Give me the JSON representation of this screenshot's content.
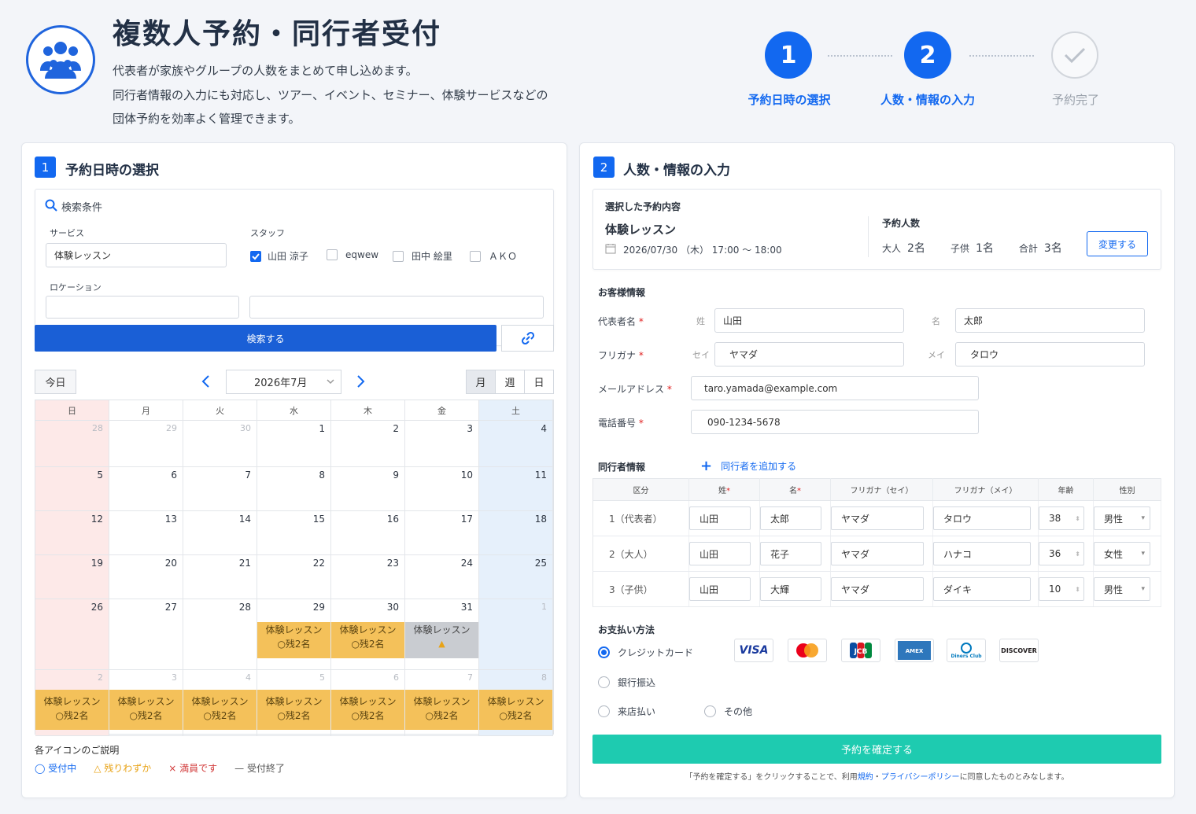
{
  "header": {
    "title": "複数人予約・同行者受付",
    "desc": [
      "代表者が家族やグループの人数をまとめて申し込めます。",
      "同行者情報の入力にも対応し、ツアー、イベント、セミナー、体験サービスなどの",
      "団体予約を効率よく管理できます。"
    ]
  },
  "steps": [
    {
      "num": "1",
      "label": "予約日時の選択"
    },
    {
      "num": "2",
      "label": "人数・情報の入力"
    },
    {
      "num": "",
      "label": "予約完了"
    }
  ],
  "left": {
    "badge": "1",
    "title": "予約日時の選択",
    "search": {
      "title": "検索条件",
      "service_label": "サービス",
      "service_value": "体験レッスン",
      "staff_label": "スタッフ",
      "staff": [
        {
          "name": "山田 涼子",
          "checked": true
        },
        {
          "name": "eqwew",
          "checked": false
        },
        {
          "name": "田中 絵里",
          "checked": false
        },
        {
          "name": "ＡＫＯ",
          "checked": false
        }
      ],
      "location_label": "ロケーション",
      "search_button": "検索する"
    },
    "toolbar": {
      "today": "今日",
      "month_value": "2026年7月",
      "views": [
        "月",
        "週",
        "日"
      ]
    },
    "weekdays": [
      "日",
      "月",
      "火",
      "水",
      "木",
      "金",
      "土"
    ],
    "weeks": [
      [
        "28",
        "29",
        "30",
        "1",
        "2",
        "3",
        "4"
      ],
      [
        "5",
        "6",
        "7",
        "8",
        "9",
        "10",
        "11"
      ],
      [
        "12",
        "13",
        "14",
        "15",
        "16",
        "17",
        "18"
      ],
      [
        "19",
        "20",
        "21",
        "22",
        "23",
        "24",
        "25"
      ],
      [
        "26",
        "27",
        "28",
        "29",
        "30",
        "31",
        "1"
      ],
      [
        "2",
        "3",
        "4",
        "5",
        "6",
        "7",
        "8"
      ]
    ],
    "events": {
      "name": "体験レッスン",
      "remain": "○残2名"
    },
    "legend": {
      "title": "各アイコンのご説明",
      "items": [
        "◯ 受付中",
        "△ 残りわずか",
        "× 満員です",
        "— 受付終了"
      ]
    }
  },
  "right": {
    "badge": "2",
    "title": "人数・情報の入力",
    "summary": {
      "heading": "選択した予約内容",
      "service": "体験レッスン",
      "datetime": "2026/07/30 （木）  17:00 ～ 18:00",
      "count_heading": "予約人数",
      "adult_label": "大人",
      "adult_value": "2名",
      "child_label": "子供",
      "child_value": "1名",
      "total_label": "合計",
      "total_value": "3名",
      "change_button": "変更する"
    },
    "customer": {
      "heading": "お客様情報",
      "name_label": "代表者名",
      "last_prefix": "姓",
      "last_value": "山田",
      "first_prefix": "名",
      "first_value": "太郎",
      "kana_label": "フリガナ",
      "kana_last_prefix": "セイ",
      "kana_last_value": "ヤマダ",
      "kana_first_prefix": "メイ",
      "kana_first_value": "タロウ",
      "email_label": "メールアドレス",
      "email_value": "taro.yamada@example.com",
      "phone_label": "電話番号",
      "phone_value": "090-1234-5678"
    },
    "companions": {
      "heading": "同行者情報",
      "add_label": "同行者を追加する",
      "columns": [
        "区分",
        "姓",
        "名",
        "フリガナ（セイ）",
        "フリガナ（メイ）",
        "年齢",
        "性別"
      ],
      "rows": [
        {
          "type": "1（代表者）",
          "last": "山田",
          "first": "太郎",
          "kana_last": "ヤマダ",
          "kana_first": "タロウ",
          "age": "38",
          "gender": "男性"
        },
        {
          "type": "2（大人）",
          "last": "山田",
          "first": "花子",
          "kana_last": "ヤマダ",
          "kana_first": "ハナコ",
          "age": "36",
          "gender": "女性"
        },
        {
          "type": "3（子供）",
          "last": "山田",
          "first": "大輝",
          "kana_last": "ヤマダ",
          "kana_first": "ダイキ",
          "age": "10",
          "gender": "男性"
        }
      ]
    },
    "payment": {
      "heading": "お支払い方法",
      "options": [
        "クレジットカード",
        "銀行振込",
        "来店払い",
        "その他"
      ],
      "cards": [
        "VISA",
        "MC",
        "JCB",
        "AMEX",
        "Diners Club",
        "DISCOVER"
      ]
    },
    "confirm_button": "予約を確定する",
    "notice": {
      "pre": "「予約を確定する」をクリックすることで、利用",
      "terms": "規約",
      "sep": "・",
      "privacy": "プライバシーポリシー",
      "post": "に同意したものとみなします。"
    }
  },
  "colors": {
    "primary": "#1268f0",
    "confirm": "#1ecbb0",
    "event": "#f4c15a"
  }
}
